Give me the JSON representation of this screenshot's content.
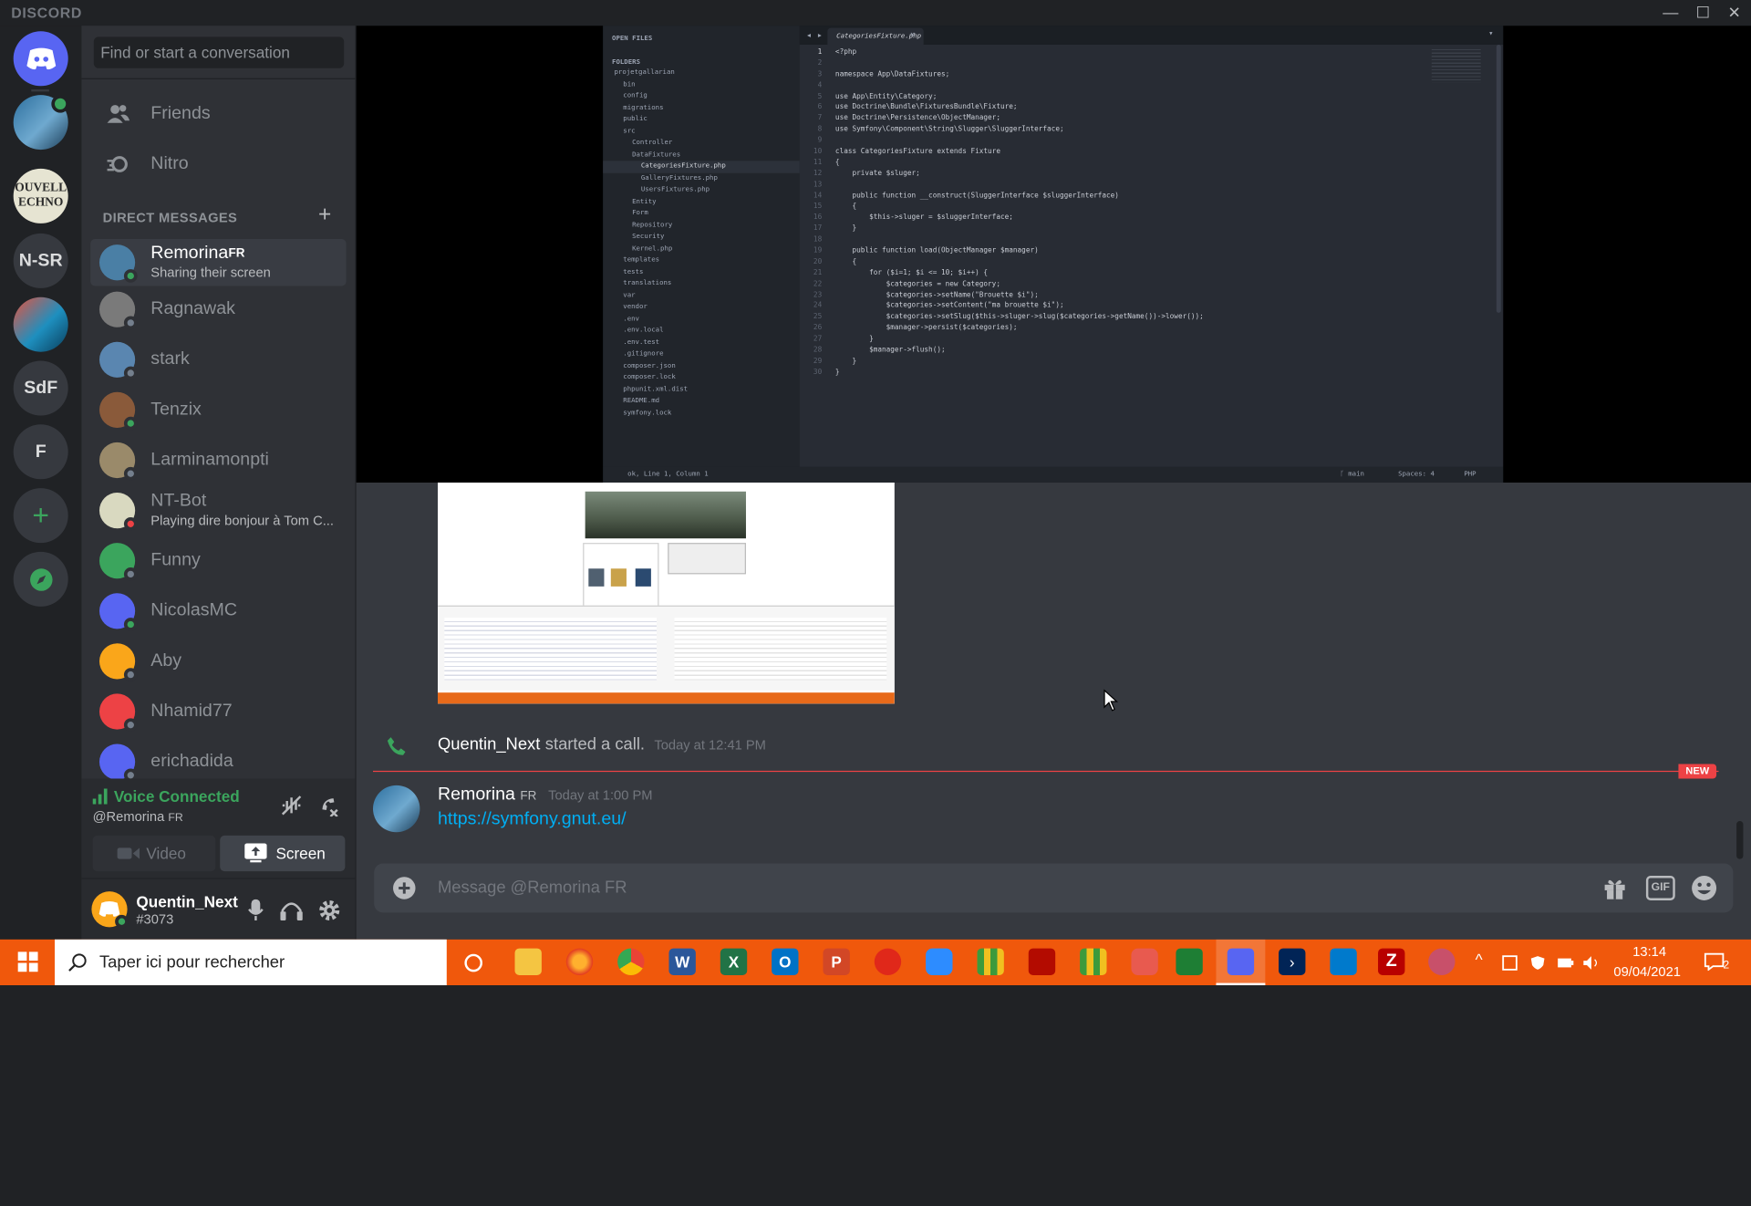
{
  "titlebar": {
    "brand": "DISCORD",
    "min": "—",
    "max": "☐",
    "close": "✕"
  },
  "guilds": [
    {
      "label": "",
      "icon": "discord-logo-icon"
    },
    {
      "label": "",
      "icon": "server-avatar-icon"
    },
    {
      "label": "OUVELL ECHNO",
      "icon": "nouvelle-techno-icon"
    },
    {
      "label": "N-SR",
      "icon": ""
    },
    {
      "label": "",
      "icon": "server-avatar-icon"
    },
    {
      "label": "SdF",
      "icon": ""
    },
    {
      "label": "F",
      "icon": ""
    },
    {
      "label": "+",
      "icon": "add-server-icon"
    },
    {
      "label": "",
      "icon": "compass-icon"
    }
  ],
  "sidebar": {
    "search_placeholder": "Find or start a conversation",
    "nav": [
      {
        "label": "Friends",
        "icon": "friends-icon"
      },
      {
        "label": "Nitro",
        "icon": "nitro-icon"
      }
    ],
    "dm_header": "DIRECT MESSAGES",
    "dm_add": "+",
    "dms": [
      {
        "name": "Remorina",
        "tag": "FR",
        "sub": "Sharing their screen",
        "status": "#3ba55d",
        "color": "#4a7fa5"
      },
      {
        "name": "Ragnawak",
        "sub": "",
        "status": "#747f8d",
        "color": "#7a7a7a"
      },
      {
        "name": "stark",
        "sub": "",
        "status": "#747f8d",
        "color": "#5a86b0"
      },
      {
        "name": "Tenzix",
        "sub": "",
        "status": "#3ba55d",
        "color": "#8a5a3a"
      },
      {
        "name": "Larminamonpti",
        "sub": "",
        "status": "#747f8d",
        "color": "#9a8a6a"
      },
      {
        "name": "NT-Bot",
        "sub": "Playing dire bonjour à Tom C...",
        "status": "#ed4245",
        "color": "#d9d9c0"
      },
      {
        "name": "Funny",
        "sub": "",
        "status": "#747f8d",
        "color": "#3ba55d"
      },
      {
        "name": "NicolasMC",
        "sub": "",
        "status": "#3ba55d",
        "color": "#5865f2"
      },
      {
        "name": "Aby",
        "sub": "",
        "status": "#747f8d",
        "color": "#faa61a"
      },
      {
        "name": "Nhamid77",
        "sub": "",
        "status": "#747f8d",
        "color": "#ed4245"
      },
      {
        "name": "erichadida",
        "sub": "",
        "status": "#747f8d",
        "color": "#5865f2"
      }
    ]
  },
  "voice": {
    "status": "Voice Connected",
    "channel": "@Remorina",
    "channel_tag": "FR",
    "video": "Video",
    "screen": "Screen"
  },
  "user": {
    "name": "Quentin_Next",
    "discriminator": "#3073"
  },
  "editor": {
    "sidebar_title": "OPEN FILES",
    "folders_title": "FOLDERS",
    "tree": [
      "projetgallarian",
      "bin",
      "config",
      "migrations",
      "public",
      "src",
      "Controller",
      "DataFixtures",
      "CategoriesFixture.php",
      "GalleryFixtures.php",
      "UsersFixtures.php",
      "Entity",
      "Form",
      "Repository",
      "Security",
      "Kernel.php",
      "templates",
      "tests",
      "translations",
      "var",
      "vendor",
      ".env",
      ".env.local",
      ".env.test",
      ".gitignore",
      "composer.json",
      "composer.lock",
      "phpunit.xml.dist",
      "README.md",
      "symfony.lock"
    ],
    "tab": "CategoriesFixture.php",
    "lines": [
      "<?php",
      "",
      "namespace App\\DataFixtures;",
      "",
      "use App\\Entity\\Category;",
      "use Doctrine\\Bundle\\FixturesBundle\\Fixture;",
      "use Doctrine\\Persistence\\ObjectManager;",
      "use Symfony\\Component\\String\\Slugger\\SluggerInterface;",
      "",
      "class CategoriesFixture extends Fixture",
      "{",
      "    private $sluger;",
      "",
      "    public function __construct(SluggerInterface $sluggerInterface)",
      "    {",
      "        $this->sluger = $sluggerInterface;",
      "    }",
      "",
      "    public function load(ObjectManager $manager)",
      "    {",
      "        for ($i=1; $i <= 10; $i++) {",
      "            $categories = new Category;",
      "            $categories->setName(\"Brouette $i\");",
      "            $categories->setContent(\"ma brouette $i\");",
      "            $categories->setSlug($this->sluger->slug($categories->getName())->lower());",
      "            $manager->persist($categories);",
      "        }",
      "        $manager->flush();",
      "    }",
      "}"
    ],
    "status_left": "ok, Line 1, Column 1",
    "status_branch": "main",
    "status_spaces": "Spaces: 4",
    "status_lang": "PHP"
  },
  "chat": {
    "call_user": "Quentin_Next",
    "call_text": "started a call.",
    "call_time": "Today at 12:41 PM",
    "new_badge": "NEW",
    "msg_user": "Remorina",
    "msg_tag": "FR",
    "msg_time": "Today at 1:00 PM",
    "msg_link": "https://symfony.gnut.eu/",
    "input_placeholder": "Message @Remorina FR"
  },
  "taskbar": {
    "search_placeholder": "Taper ici pour rechercher",
    "time": "13:14",
    "date": "09/04/2021",
    "notif_count": "2"
  }
}
